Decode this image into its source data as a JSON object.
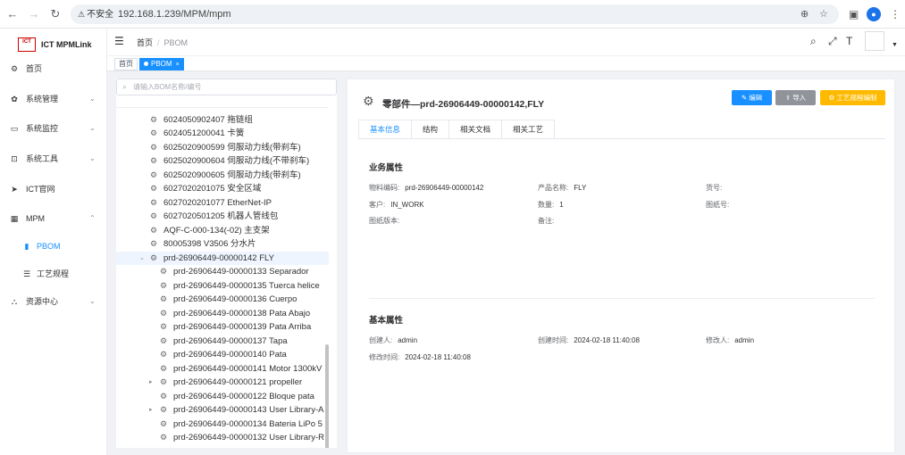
{
  "browser": {
    "security_label": "不安全",
    "url": "192.168.1.239/MPM/mpm"
  },
  "sidebar": {
    "brand_logo": "ICT",
    "brand_name": "ICT MPMLink",
    "items": [
      {
        "label": "首页"
      },
      {
        "label": "系统管理"
      },
      {
        "label": "系统监控"
      },
      {
        "label": "系统工具"
      },
      {
        "label": "ICT官网"
      },
      {
        "label": "MPM"
      },
      {
        "label": "PBOM"
      },
      {
        "label": "工艺规程"
      },
      {
        "label": "资源中心"
      }
    ]
  },
  "header": {
    "breadcrumb": [
      "首页",
      "PBOM"
    ]
  },
  "tags": [
    {
      "label": "首页"
    },
    {
      "label": "PBOM"
    }
  ],
  "tree": {
    "search_placeholder": "请输入BOM名称/编号",
    "nodes": [
      {
        "label": "6024050902407 拖链组"
      },
      {
        "label": "6024051200041 卡簧"
      },
      {
        "label": "6025020900599 伺服动力线(带刹车)"
      },
      {
        "label": "6025020900604 伺服动力线(不带刹车)"
      },
      {
        "label": "6025020900605 伺服动力线(带刹车)"
      },
      {
        "label": "6027020201075 安全区域"
      },
      {
        "label": "6027020201077 EtherNet-IP"
      },
      {
        "label": "6027020501205 机器人管线包"
      },
      {
        "label": "AQF-C-000-134(-02) 主支架"
      },
      {
        "label": "80005398 V3506 分水片"
      },
      {
        "label": "prd-26906449-00000142 FLY"
      },
      {
        "label": "prd-26906449-00000133 Separador"
      },
      {
        "label": "prd-26906449-00000135 Tuerca helice"
      },
      {
        "label": "prd-26906449-00000136 Cuerpo"
      },
      {
        "label": "prd-26906449-00000138 Pata Abajo"
      },
      {
        "label": "prd-26906449-00000139 Pata Arriba"
      },
      {
        "label": "prd-26906449-00000137 Tapa"
      },
      {
        "label": "prd-26906449-00000140 Pata"
      },
      {
        "label": "prd-26906449-00000141 Motor 1300kV"
      },
      {
        "label": "prd-26906449-00000121 propeller"
      },
      {
        "label": "prd-26906449-00000122 Bloque pata"
      },
      {
        "label": "prd-26906449-00000143 User Library-A"
      },
      {
        "label": "prd-26906449-00000134 Bateria LiPo 5"
      },
      {
        "label": "prd-26906449-00000132 User Library-R"
      }
    ]
  },
  "detail": {
    "title": "零部件—prd-26906449-00000142,FLY",
    "buttons": {
      "edit": "编辑",
      "import": "导入",
      "process": "工艺规程编制"
    },
    "tabs": [
      "基本信息",
      "结构",
      "相关文档",
      "相关工艺"
    ],
    "business_title": "业务属性",
    "business": {
      "material_code_label": "物料编码:",
      "material_code": "prd-26906449-00000142",
      "product_name_label": "产品名称:",
      "product_name": "FLY",
      "goods_no_label": "货号:",
      "goods_no": "",
      "customer_label": "客户:",
      "customer": "IN_WORK",
      "quantity_label": "数量:",
      "quantity": "1",
      "drawing_no_label": "图纸号:",
      "drawing_no": "",
      "drawing_version_label": "图纸版本:",
      "drawing_version": "",
      "remark_label": "备注:",
      "remark": ""
    },
    "basic_title": "基本属性",
    "basic": {
      "creator_label": "创建人:",
      "creator": "admin",
      "created_label": "创建时间:",
      "created": "2024-02-18 11:40:08",
      "modifier_label": "修改人:",
      "modifier": "admin",
      "modified_label": "修改时间:",
      "modified": "2024-02-18 11:40:08"
    }
  }
}
